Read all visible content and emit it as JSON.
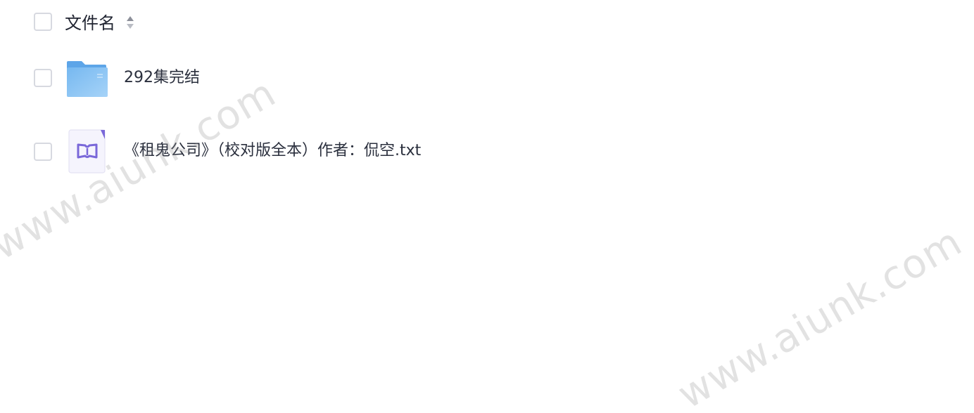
{
  "header": {
    "column_label": "文件名",
    "sort_icon": "sort-up-down-icon"
  },
  "rows": [
    {
      "name": "292集完结",
      "type": "folder",
      "icon": "folder-icon"
    },
    {
      "name": "《租鬼公司》（校对版全本）作者：侃空.txt",
      "type": "txt",
      "icon": "text-file-book-icon"
    }
  ],
  "watermarks": [
    "www.aiunk.com",
    "www.aiunk.com"
  ],
  "colors": {
    "folder_blue": "#6fb3ee",
    "book_purple": "#7a68d9",
    "checkbox_border": "#d7d9e0"
  }
}
